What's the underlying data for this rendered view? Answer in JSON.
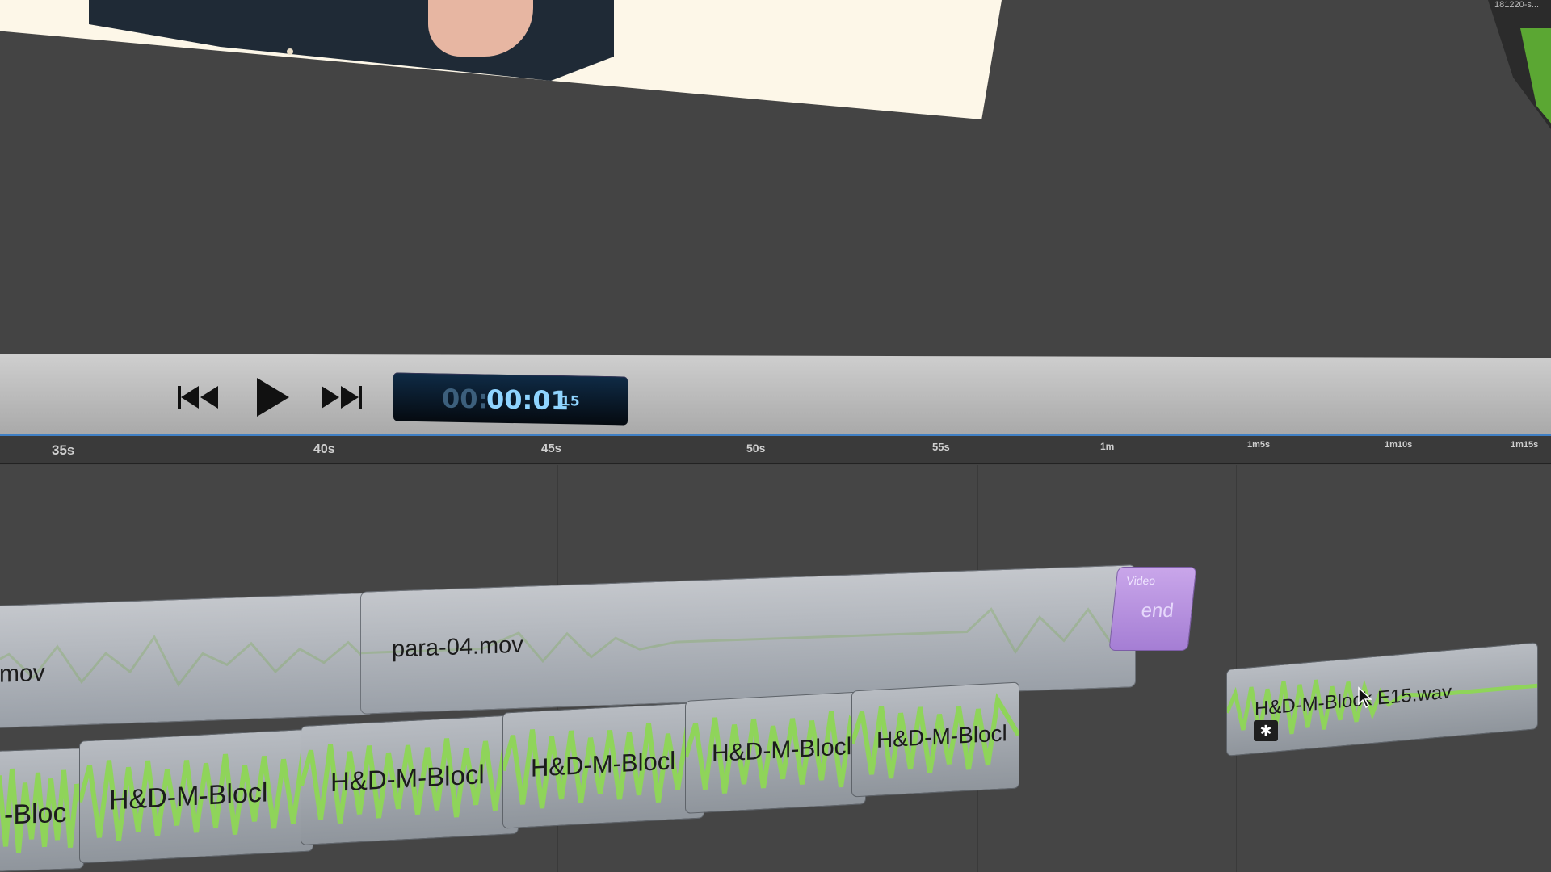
{
  "transport": {
    "timecode": {
      "dim": "00:",
      "main": "00:01",
      "frames": "15"
    },
    "buttons": [
      "skip-back",
      "play",
      "skip-forward"
    ]
  },
  "ruler": {
    "ticks": [
      "35s",
      "40s",
      "45s",
      "50s",
      "55s",
      "1m",
      "1m5s",
      "1m10s",
      "1m15s"
    ]
  },
  "viewer": {
    "thumbnail_label": "181220-s..."
  },
  "tracks": {
    "video_clips": [
      {
        "label": "mov"
      },
      {
        "label": "para-04.mov"
      }
    ],
    "end_clip": {
      "small": "Video",
      "big": "end"
    },
    "audio_clips": [
      {
        "label": "-Bloc"
      },
      {
        "label": "H&D-M-Blocl"
      },
      {
        "label": "H&D-M-Blocl"
      },
      {
        "label": "H&D-M-Blocl"
      },
      {
        "label": "H&D-M-Blocl"
      },
      {
        "label": "H&D-M-Blocl"
      }
    ],
    "audio_right": {
      "label": "H&D-M-Block E15.wav"
    }
  },
  "colors": {
    "accent": "#3f7fc4",
    "waveform": "#8fd45a",
    "timecode": "#8fd4ff",
    "end_clip": "#b48fe0"
  }
}
